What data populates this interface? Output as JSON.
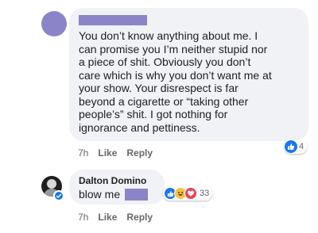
{
  "comment1": {
    "text": "You don’t know anything about me. I\ncan promise you I’m neither stupid nor\na piece of shit. Obviously you don’t\ncare which is why you don’t want me at\nyour show. Your disrespect is far\nbeyond a cigarette or “taking other\npeople’s” shit. I got nothing for\nignorance and pettiness.",
    "time": "7h",
    "like_label": "Like",
    "reply_label": "Reply",
    "reaction_count": "4",
    "reaction_icons": [
      "like-icon"
    ]
  },
  "comment2": {
    "author": "Dalton Domino",
    "text": "blow me",
    "time": "7h",
    "like_label": "Like",
    "reply_label": "Reply",
    "reaction_count": "33",
    "reaction_icons": [
      "like-icon",
      "haha-icon",
      "love-icon"
    ]
  },
  "colors": {
    "redaction": "#8b84c8",
    "bubble": "#f0f2f5",
    "meta_text": "#65676b",
    "like_blue": "#1877f2",
    "haha_yellow": "#f7c440",
    "love_red": "#f33e58"
  }
}
